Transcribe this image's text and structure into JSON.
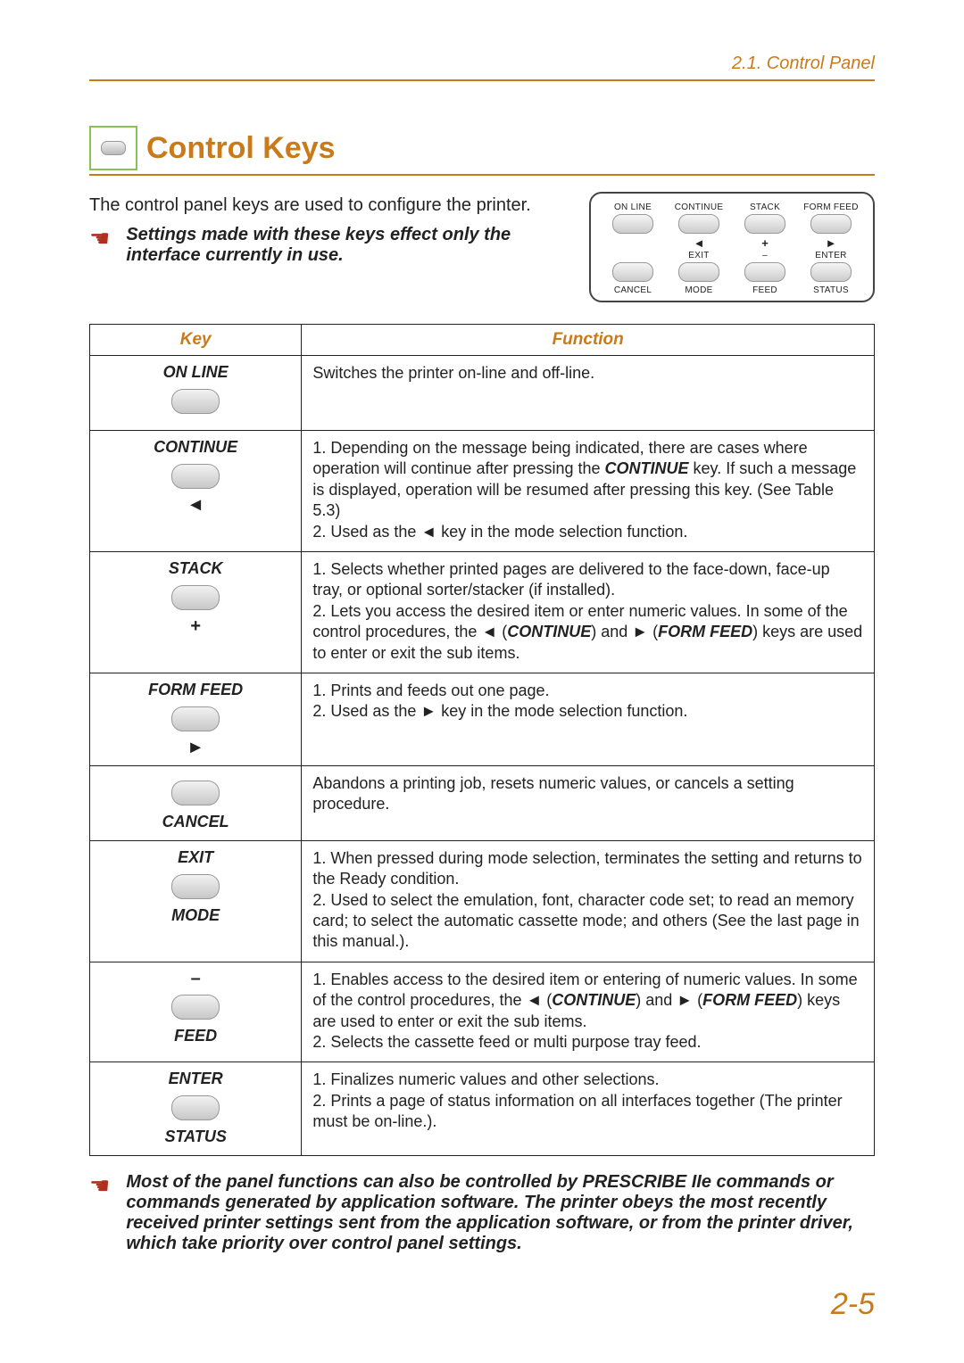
{
  "header": {
    "breadcrumb": "2.1. Control Panel"
  },
  "section": {
    "title": "Control Keys",
    "intro": "The control panel keys are used to configure the printer.",
    "note1": "Settings made with these keys effect only the interface currently in use.",
    "note2": "Most of the panel functions can also be controlled by PRESCRIBE IIe commands or commands generated by application software. The printer obeys the most recently received printer settings sent from the application software, or from the printer driver, which take priority over control panel settings."
  },
  "panel": {
    "row1": [
      "ON LINE",
      "CONTINUE",
      "STACK",
      "FORM FEED"
    ],
    "row2_sym": [
      "",
      "◄",
      "+",
      "►"
    ],
    "row2_label": [
      "",
      "EXIT",
      "–",
      "ENTER"
    ],
    "row3_label": [
      "CANCEL",
      "MODE",
      "FEED",
      "STATUS"
    ]
  },
  "table": {
    "head_key": "Key",
    "head_func": "Function",
    "rows": [
      {
        "key_name": "ON LINE",
        "symbols": [],
        "extra_label": "",
        "func_html": "Switches the printer on-line and off-line."
      },
      {
        "key_name": "CONTINUE",
        "symbols": [
          "◄"
        ],
        "extra_label": "",
        "func_parts": {
          "p1": "1. Depending on the message being indicated, there are cases where operation will continue after pressing the ",
          "k1": "CONTINUE",
          "p2": " key. If such a message is displayed, operation will be resumed after pressing this key. (See Table 5.3)",
          "p3": "2. Used as the  ◄  key in the mode selection function."
        }
      },
      {
        "key_name": "STACK",
        "symbols": [
          "+"
        ],
        "extra_label": "",
        "func_parts": {
          "p1": "1. Selects whether printed pages are delivered to the face-down, face-up tray, or optional sorter/stacker (if installed).",
          "p2a": "2. Lets you access the desired item or enter numeric values. In some of the control procedures, the ◄ (",
          "k1": "CONTINUE",
          "p2b": ") and ► (",
          "k2": "FORM FEED",
          "p2c": ") keys are used to enter or exit the sub items."
        }
      },
      {
        "key_name": "FORM FEED",
        "symbols": [
          "►"
        ],
        "extra_label": "",
        "func_parts": {
          "p1": "1. Prints and feeds out one page.",
          "p2": "2.  Used as the ►  key in the mode selection function."
        }
      },
      {
        "key_name": "",
        "symbols": [],
        "extra_label": "CANCEL",
        "func_html": "Abandons a printing job, resets numeric values, or cancels a setting procedure."
      },
      {
        "key_name": "EXIT",
        "symbols": [],
        "extra_label": "MODE",
        "func_parts": {
          "p1": "1. When pressed during mode selection, terminates the setting and returns to the Ready condition.",
          "p2": "2. Used to select the emulation, font, character code set; to read an memory card; to select the automatic cassette mode; and others (See the last page in this manual.)."
        }
      },
      {
        "key_name": "–",
        "key_name_is_symbol": true,
        "symbols": [],
        "extra_label": "FEED",
        "func_parts": {
          "p1a": "1. Enables access to the desired item or entering of numeric values. In some of the control procedures, the ◄ (",
          "k1": "CONTINUE",
          "p1b": ") and ► (",
          "k2": "FORM FEED",
          "p1c": ") keys are used to enter or exit the sub items.",
          "p2": "2. Selects the cassette feed or multi purpose tray feed."
        }
      },
      {
        "key_name": "ENTER",
        "symbols": [],
        "extra_label": "STATUS",
        "func_parts": {
          "p1": "1. Finalizes numeric values and other selections.",
          "p2": "2. Prints a page of status information on all interfaces together (The printer must be on-line.)."
        }
      }
    ]
  },
  "page_number": "2-5"
}
